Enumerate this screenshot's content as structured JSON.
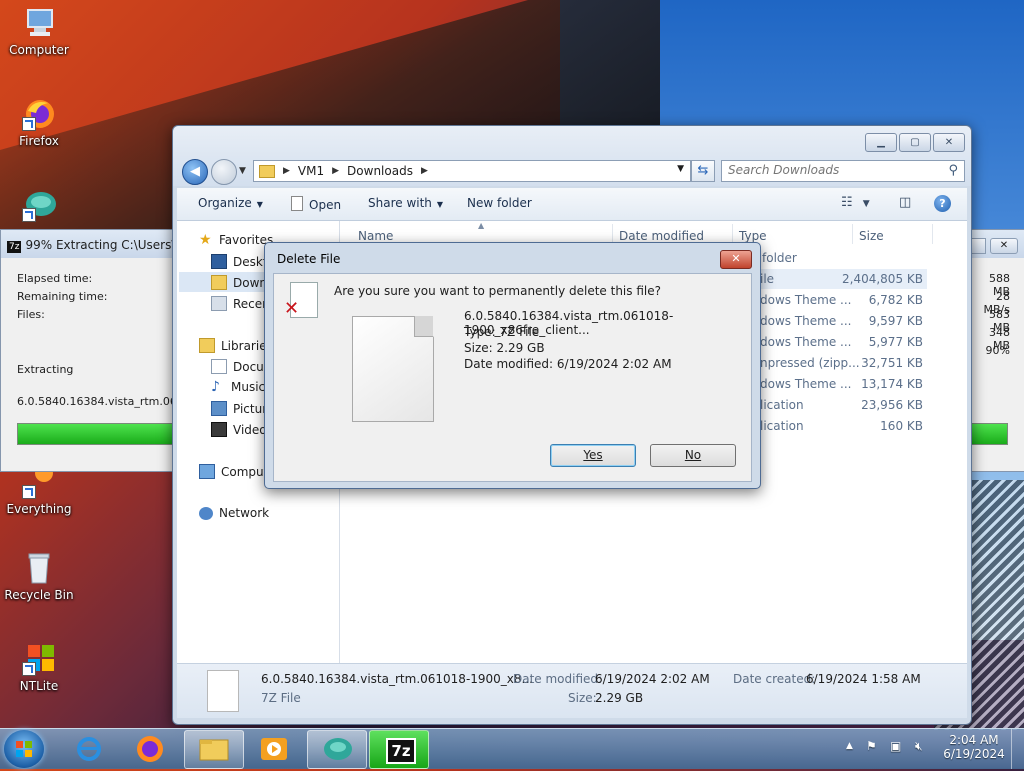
{
  "desktop": {
    "icons": [
      {
        "label": "Computer"
      },
      {
        "label": "Firefox"
      },
      {
        "label": ""
      },
      {
        "label": "Everything"
      },
      {
        "label": "Recycle Bin"
      },
      {
        "label": "NTLite"
      }
    ]
  },
  "zip_window": {
    "title": "99% Extracting C:\\Users\\VM",
    "elapsed_label": "Elapsed time:",
    "remaining_label": "Remaining time:",
    "files_label": "Files:",
    "extracting_label": "Extracting",
    "current_file": "6.0.5840.16384.vista_rtm.061018",
    "right_values": [
      "588 MB",
      "28 MB/s",
      "583 MB",
      "348 MB",
      "90%"
    ],
    "progress": 0.99
  },
  "explorer": {
    "breadcrumb": [
      "VM1",
      "Downloads"
    ],
    "search_placeholder": "Search Downloads",
    "toolbar": {
      "organize": "Organize",
      "open": "Open",
      "share_with": "Share with",
      "new_folder": "New folder"
    },
    "nav": {
      "favorites": "Favorites",
      "desktop": "Deskto",
      "downloads": "Downl",
      "recent": "Recen",
      "libraries": "Libraries",
      "documents": "Docu",
      "music": "Music",
      "pictures": "Picture",
      "videos": "Videos",
      "computer": "Comput",
      "network": "Network"
    },
    "columns": {
      "name": "Name",
      "date_modified": "Date modified",
      "type": "Type",
      "size": "Size"
    },
    "rows": [
      {
        "type": "folder",
        "size": ""
      },
      {
        "type": "ile",
        "size": "2,404,805 KB"
      },
      {
        "type": "dows Theme ...",
        "size": "6,782 KB"
      },
      {
        "type": "dows Theme ...",
        "size": "9,597 KB"
      },
      {
        "type": "dows Theme ...",
        "size": "5,977 KB"
      },
      {
        "type": "npressed (zipp...",
        "size": "32,751 KB"
      },
      {
        "type": "dows Theme ...",
        "size": "13,174 KB"
      },
      {
        "type": "lication",
        "size": "23,956 KB"
      },
      {
        "type": "lication",
        "size": "160 KB"
      }
    ],
    "details": {
      "filename": "6.0.5840.16384.vista_rtm.061018-1900_x8...",
      "filetype": "7Z File",
      "modified_label": "Date modified:",
      "modified_value": "6/19/2024 2:02 AM",
      "size_label": "Size:",
      "size_value": "2.29 GB",
      "created_label": "Date created:",
      "created_value": "6/19/2024 1:58 AM"
    }
  },
  "dialog": {
    "title": "Delete File",
    "question": "Are you sure you want to permanently delete this file?",
    "file_name": "6.0.5840.16384.vista_rtm.061018-1900_x86fre_client...",
    "file_type": "Type: 7Z File",
    "file_size": "Size: 2.29 GB",
    "file_date": "Date modified: 6/19/2024 2:02 AM",
    "yes": "Yes",
    "no": "No"
  },
  "taskbar": {
    "time": "2:04 AM",
    "date": "6/19/2024",
    "sevenzip_label": "7z"
  },
  "colors": {
    "progress_green": "#1aac1a",
    "accent_blue": "#2a67b8",
    "close_red": "#c0432d"
  }
}
